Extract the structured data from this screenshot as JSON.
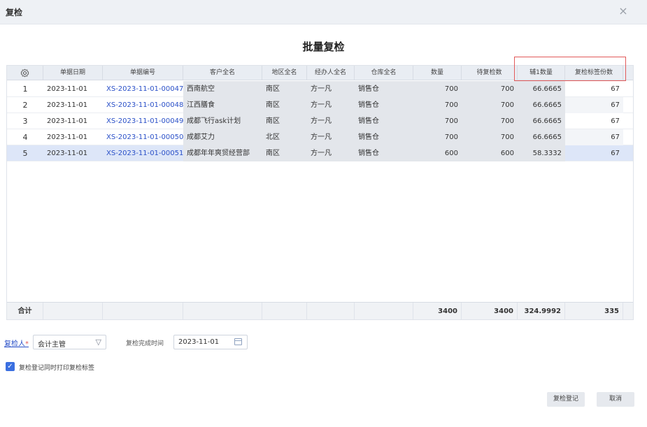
{
  "dialog": {
    "title": "复检",
    "close_glyph": "×"
  },
  "main_title": "批量复检",
  "table": {
    "settings_icon": "gear-icon",
    "headers": [
      "单据日期",
      "单据编号",
      "客户全名",
      "地区全名",
      "经办人全名",
      "仓库全名",
      "数量",
      "待复检数",
      "辅1数量",
      "复检标签份数"
    ],
    "rows": [
      {
        "num": "1",
        "date": "2023-11-01",
        "code": "XS-2023-11-01-00047",
        "customer": "西南航空",
        "region": "南区",
        "handler": "方一凡",
        "warehouse": "销售仓",
        "qty": "700",
        "pending": "700",
        "aux1": "66.6665",
        "labels": "67"
      },
      {
        "num": "2",
        "date": "2023-11-01",
        "code": "XS-2023-11-01-00048",
        "customer": "江西膳食",
        "region": "南区",
        "handler": "方一凡",
        "warehouse": "销售仓",
        "qty": "700",
        "pending": "700",
        "aux1": "66.6665",
        "labels": "67"
      },
      {
        "num": "3",
        "date": "2023-11-01",
        "code": "XS-2023-11-01-00049",
        "customer": "成都飞行ask计划",
        "region": "南区",
        "handler": "方一凡",
        "warehouse": "销售仓",
        "qty": "700",
        "pending": "700",
        "aux1": "66.6665",
        "labels": "67"
      },
      {
        "num": "4",
        "date": "2023-11-01",
        "code": "XS-2023-11-01-00050",
        "customer": "成都艾力",
        "region": "北区",
        "handler": "方一凡",
        "warehouse": "销售仓",
        "qty": "700",
        "pending": "700",
        "aux1": "66.6665",
        "labels": "67"
      },
      {
        "num": "5",
        "date": "2023-11-01",
        "code": "XS-2023-11-01-00051",
        "customer": "成都年年爽贸经营部",
        "region": "南区",
        "handler": "方一凡",
        "warehouse": "销售仓",
        "qty": "600",
        "pending": "600",
        "aux1": "58.3332",
        "labels": "67"
      }
    ],
    "footer": {
      "label": "合计",
      "qty": "3400",
      "pending": "3400",
      "aux1": "324.9992",
      "labels": "335"
    }
  },
  "form": {
    "reviewer_label": "复检人",
    "required_mark": "*",
    "reviewer_value": "会计主管",
    "filter_glyph": "▽",
    "date_label": "复检完成时间",
    "date_value": "2023-11-01",
    "print_checkbox_label": "复检登记同时打印复检标签",
    "print_checked": true,
    "check_glyph": "✓"
  },
  "buttons": {
    "confirm": "复检登记",
    "cancel": "取消"
  },
  "colors": {
    "accent": "#2a50c8",
    "highlight": "#e25a5a",
    "checkbox": "#3a6fe0"
  }
}
